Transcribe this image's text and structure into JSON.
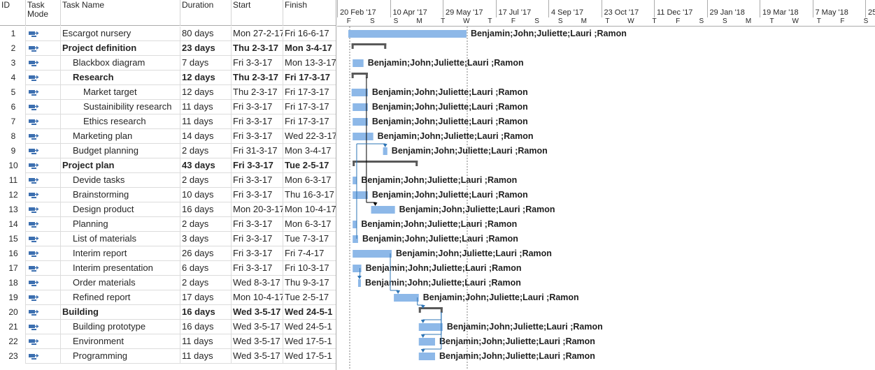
{
  "columns": {
    "id": "ID",
    "mode_line1": "Task",
    "mode_line2": "Mode",
    "name": "Task Name",
    "duration": "Duration",
    "start": "Start",
    "finish": "Finish"
  },
  "timescale": {
    "top": [
      "20 Feb '17",
      "10 Apr '17",
      "29 May '17",
      "17 Jul '17",
      "4 Sep '17",
      "23 Oct '17",
      "11 Dec '17",
      "29 Jan '18",
      "19 Mar '18",
      "7 May '18",
      "25"
    ],
    "bottom": [
      "F",
      "S",
      "S",
      "M",
      "T",
      "W",
      "T",
      "F",
      "S",
      "S",
      "M",
      "T",
      "W",
      "T",
      "F",
      "S",
      "S",
      "M",
      "T",
      "W",
      "T",
      "F",
      "S"
    ]
  },
  "tasks": [
    {
      "id": "1",
      "name": "Escargot nursery",
      "duration": "80 days",
      "start": "Mon 27-2-17",
      "finish": "Fri 16-6-17",
      "indent": 0,
      "summary": false,
      "resources": "Benjamin;John;Juliette;Lauri ;Ramon",
      "bar_start_day": 0,
      "bar_days": 109
    },
    {
      "id": "2",
      "name": "Project definition",
      "duration": "23 days",
      "start": "Thu 2-3-17",
      "finish": "Mon 3-4-17",
      "indent": 0,
      "summary": true,
      "resources": "",
      "bar_start_day": 3,
      "bar_days": 32
    },
    {
      "id": "3",
      "name": "Blackbox diagram",
      "duration": "7 days",
      "start": "Fri 3-3-17",
      "finish": "Mon 13-3-17",
      "indent": 1,
      "summary": false,
      "resources": "Benjamin;John;Juliette;Lauri ;Ramon",
      "bar_start_day": 4,
      "bar_days": 10
    },
    {
      "id": "4",
      "name": "Research",
      "duration": "12 days",
      "start": "Thu 2-3-17",
      "finish": "Fri 17-3-17",
      "indent": 1,
      "summary": true,
      "resources": "",
      "bar_start_day": 3,
      "bar_days": 15
    },
    {
      "id": "5",
      "name": "Market target",
      "duration": "12 days",
      "start": "Thu 2-3-17",
      "finish": "Fri 17-3-17",
      "indent": 2,
      "summary": false,
      "resources": "Benjamin;John;Juliette;Lauri ;Ramon",
      "bar_start_day": 3,
      "bar_days": 15
    },
    {
      "id": "6",
      "name": "Sustainibility research",
      "duration": "11 days",
      "start": "Fri 3-3-17",
      "finish": "Fri 17-3-17",
      "indent": 2,
      "summary": false,
      "resources": "Benjamin;John;Juliette;Lauri ;Ramon",
      "bar_start_day": 4,
      "bar_days": 14
    },
    {
      "id": "7",
      "name": "Ethics research",
      "duration": "11 days",
      "start": "Fri 3-3-17",
      "finish": "Fri 17-3-17",
      "indent": 2,
      "summary": false,
      "resources": "Benjamin;John;Juliette;Lauri ;Ramon",
      "bar_start_day": 4,
      "bar_days": 14
    },
    {
      "id": "8",
      "name": "Marketing plan",
      "duration": "14 days",
      "start": "Fri 3-3-17",
      "finish": "Wed 22-3-17",
      "indent": 1,
      "summary": false,
      "resources": "Benjamin;John;Juliette;Lauri ;Ramon",
      "bar_start_day": 4,
      "bar_days": 19
    },
    {
      "id": "9",
      "name": "Budget planning",
      "duration": "2 days",
      "start": "Fri 31-3-17",
      "finish": "Mon 3-4-17",
      "indent": 1,
      "summary": false,
      "resources": "Benjamin;John;Juliette;Lauri ;Ramon",
      "bar_start_day": 32,
      "bar_days": 4
    },
    {
      "id": "10",
      "name": "Project plan",
      "duration": "43 days",
      "start": "Fri 3-3-17",
      "finish": "Tue 2-5-17",
      "indent": 0,
      "summary": true,
      "resources": "",
      "bar_start_day": 4,
      "bar_days": 60
    },
    {
      "id": "11",
      "name": "Devide tasks",
      "duration": "2 days",
      "start": "Fri 3-3-17",
      "finish": "Mon 6-3-17",
      "indent": 1,
      "summary": false,
      "resources": "Benjamin;John;Juliette;Lauri ;Ramon",
      "bar_start_day": 4,
      "bar_days": 4
    },
    {
      "id": "12",
      "name": "Brainstorming",
      "duration": "10 days",
      "start": "Fri 3-3-17",
      "finish": "Thu 16-3-17",
      "indent": 1,
      "summary": false,
      "resources": "Benjamin;John;Juliette;Lauri ;Ramon",
      "bar_start_day": 4,
      "bar_days": 14
    },
    {
      "id": "13",
      "name": "Design product",
      "duration": "16 days",
      "start": "Mon 20-3-17",
      "finish": "Mon 10-4-17",
      "indent": 1,
      "summary": false,
      "resources": "Benjamin;John;Juliette;Lauri ;Ramon",
      "bar_start_day": 21,
      "bar_days": 22
    },
    {
      "id": "14",
      "name": "Planning",
      "duration": "2 days",
      "start": "Fri 3-3-17",
      "finish": "Mon 6-3-17",
      "indent": 1,
      "summary": false,
      "resources": "Benjamin;John;Juliette;Lauri ;Ramon",
      "bar_start_day": 4,
      "bar_days": 4
    },
    {
      "id": "15",
      "name": "List of materials",
      "duration": "3 days",
      "start": "Fri 3-3-17",
      "finish": "Tue 7-3-17",
      "indent": 1,
      "summary": false,
      "resources": "Benjamin;John;Juliette;Lauri ;Ramon",
      "bar_start_day": 4,
      "bar_days": 5
    },
    {
      "id": "16",
      "name": "Interim report",
      "duration": "26 days",
      "start": "Fri 3-3-17",
      "finish": "Fri 7-4-17",
      "indent": 1,
      "summary": false,
      "resources": "Benjamin;John;Juliette;Lauri ;Ramon",
      "bar_start_day": 4,
      "bar_days": 36
    },
    {
      "id": "17",
      "name": "Interim presentation",
      "duration": "6 days",
      "start": "Fri 3-3-17",
      "finish": "Fri 10-3-17",
      "indent": 1,
      "summary": false,
      "resources": "Benjamin;John;Juliette;Lauri ;Ramon",
      "bar_start_day": 4,
      "bar_days": 8
    },
    {
      "id": "18",
      "name": "Order materials",
      "duration": "2 days",
      "start": "Wed 8-3-17",
      "finish": "Thu 9-3-17",
      "indent": 1,
      "summary": false,
      "resources": "Benjamin;John;Juliette;Lauri ;Ramon",
      "bar_start_day": 9,
      "bar_days": 2
    },
    {
      "id": "19",
      "name": "Refined report",
      "duration": "17 days",
      "start": "Mon 10-4-17",
      "finish": "Tue 2-5-17",
      "indent": 1,
      "summary": false,
      "resources": "Benjamin;John;Juliette;Lauri ;Ramon",
      "bar_start_day": 42,
      "bar_days": 23
    },
    {
      "id": "20",
      "name": "Building",
      "duration": "16 days",
      "start": "Wed 3-5-17",
      "finish": "Wed 24-5-1",
      "indent": 0,
      "summary": true,
      "resources": "",
      "bar_start_day": 65,
      "bar_days": 22
    },
    {
      "id": "21",
      "name": "Building prototype",
      "duration": "16 days",
      "start": "Wed 3-5-17",
      "finish": "Wed 24-5-1",
      "indent": 1,
      "summary": false,
      "resources": "Benjamin;John;Juliette;Lauri ;Ramon",
      "bar_start_day": 65,
      "bar_days": 22
    },
    {
      "id": "22",
      "name": "Environment",
      "duration": "11 days",
      "start": "Wed 3-5-17",
      "finish": "Wed 17-5-1",
      "indent": 1,
      "summary": false,
      "resources": "Benjamin;John;Juliette;Lauri ;Ramon",
      "bar_start_day": 65,
      "bar_days": 15
    },
    {
      "id": "23",
      "name": "Programming",
      "duration": "11 days",
      "start": "Wed 3-5-17",
      "finish": "Wed 17-5-1",
      "indent": 1,
      "summary": false,
      "resources": "Benjamin;John;Juliette;Lauri ;Ramon",
      "bar_start_day": 65,
      "bar_days": 15
    }
  ],
  "colors": {
    "task_bar": "#8db8e8",
    "summary_bar": "#595959",
    "link_black": "#000000",
    "link_blue": "#2e75b6",
    "icon_blue": "#3c6fb0"
  }
}
